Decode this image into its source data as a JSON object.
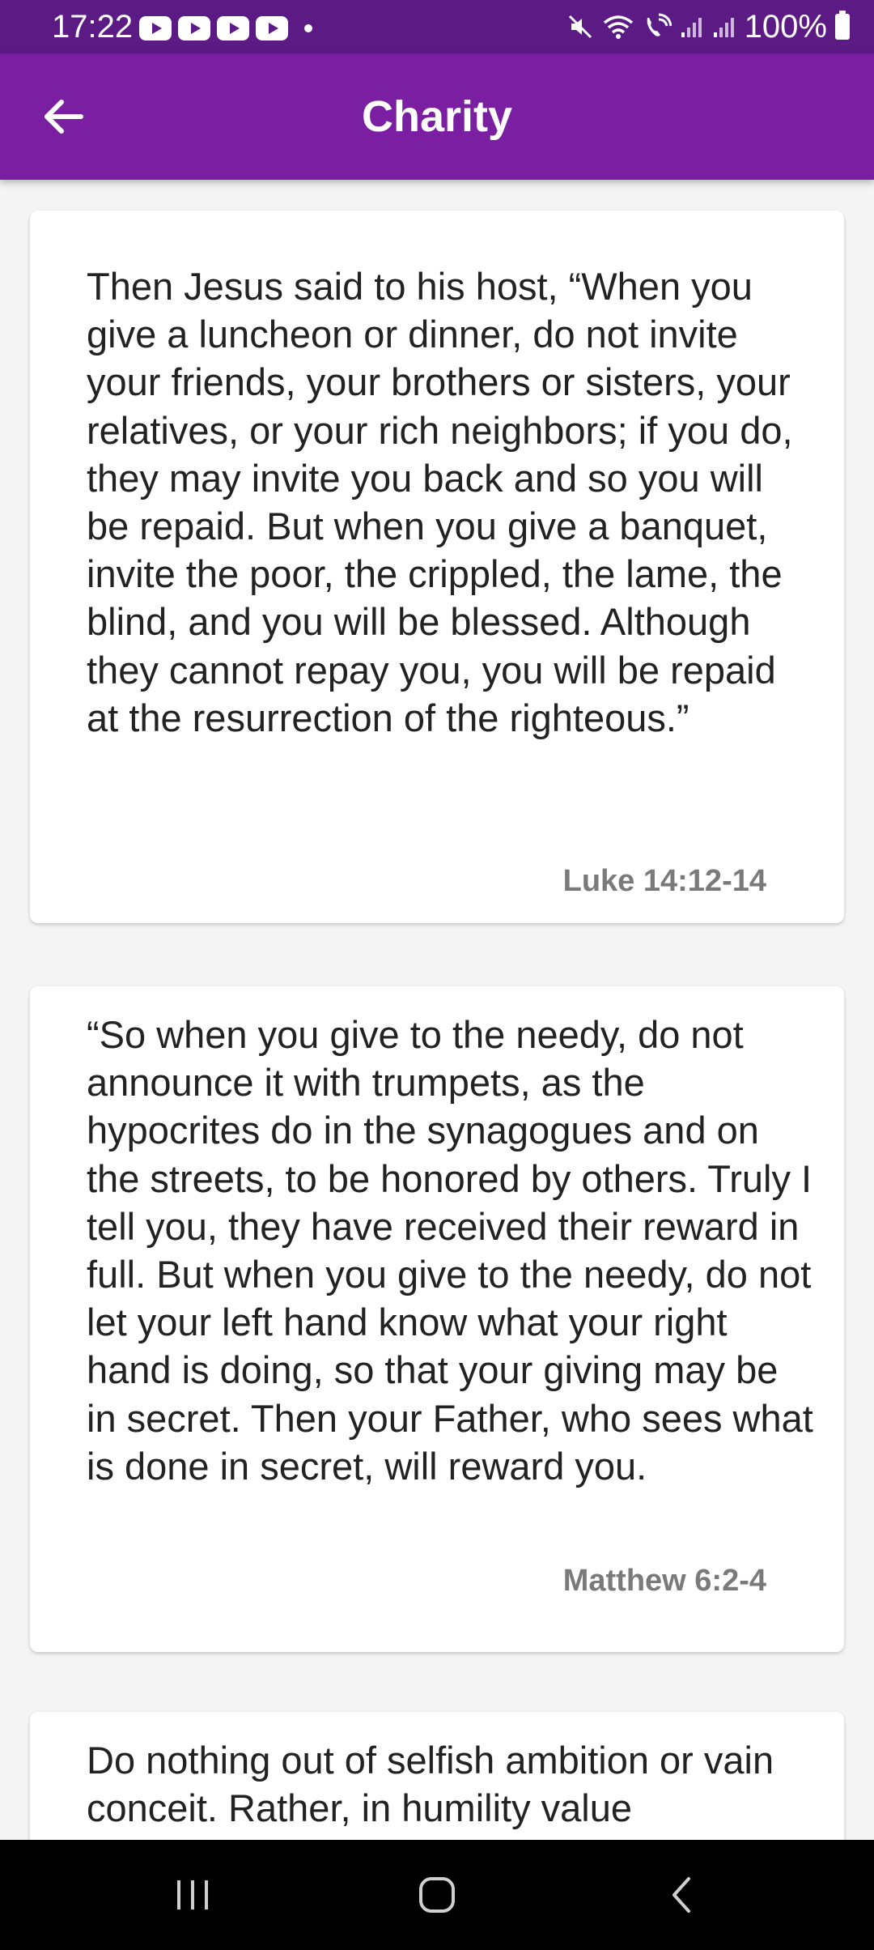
{
  "status_bar": {
    "time": "17:22",
    "battery": "100%"
  },
  "app_bar": {
    "title": "Charity"
  },
  "cards": [
    {
      "text": "Then Jesus said to his host, “When you give a luncheon or dinner, do not invite your friends, your brothers or sisters, your relatives, or your rich neighbors; if you do, they may invite you back and so you will be repaid. But when you give a banquet, invite the poor, the crippled, the lame, the blind, and you will be blessed. Although they cannot repay you, you will be repaid at the resurrection of the righteous.”",
      "book": "Luke",
      "verse": "14:12-14"
    },
    {
      "text": "“So when you give to the needy, do not announce it with trumpets, as the hypocrites do in the synagogues and on the streets, to be honored by others. Truly I tell you, they have received their reward in full. But when you give to the needy, do not let your left hand know what your right hand is doing, so that your giving may be in secret. Then your Father, who sees what is done in secret, will reward you.",
      "book": "Matthew",
      "verse": "6:2-4"
    },
    {
      "text": "Do nothing out of selfish ambition or vain conceit. Rather, in humility value"
    }
  ],
  "colors": {
    "status_bar": "#5b1a84",
    "app_bar": "#7b1fa2",
    "background": "#f4f4f4",
    "reference_text": "#7a7a7a"
  },
  "icons": {
    "back": "arrow-left-icon",
    "nav_recents": "recents-icon",
    "nav_home": "home-icon",
    "nav_back": "chevron-left-icon"
  }
}
